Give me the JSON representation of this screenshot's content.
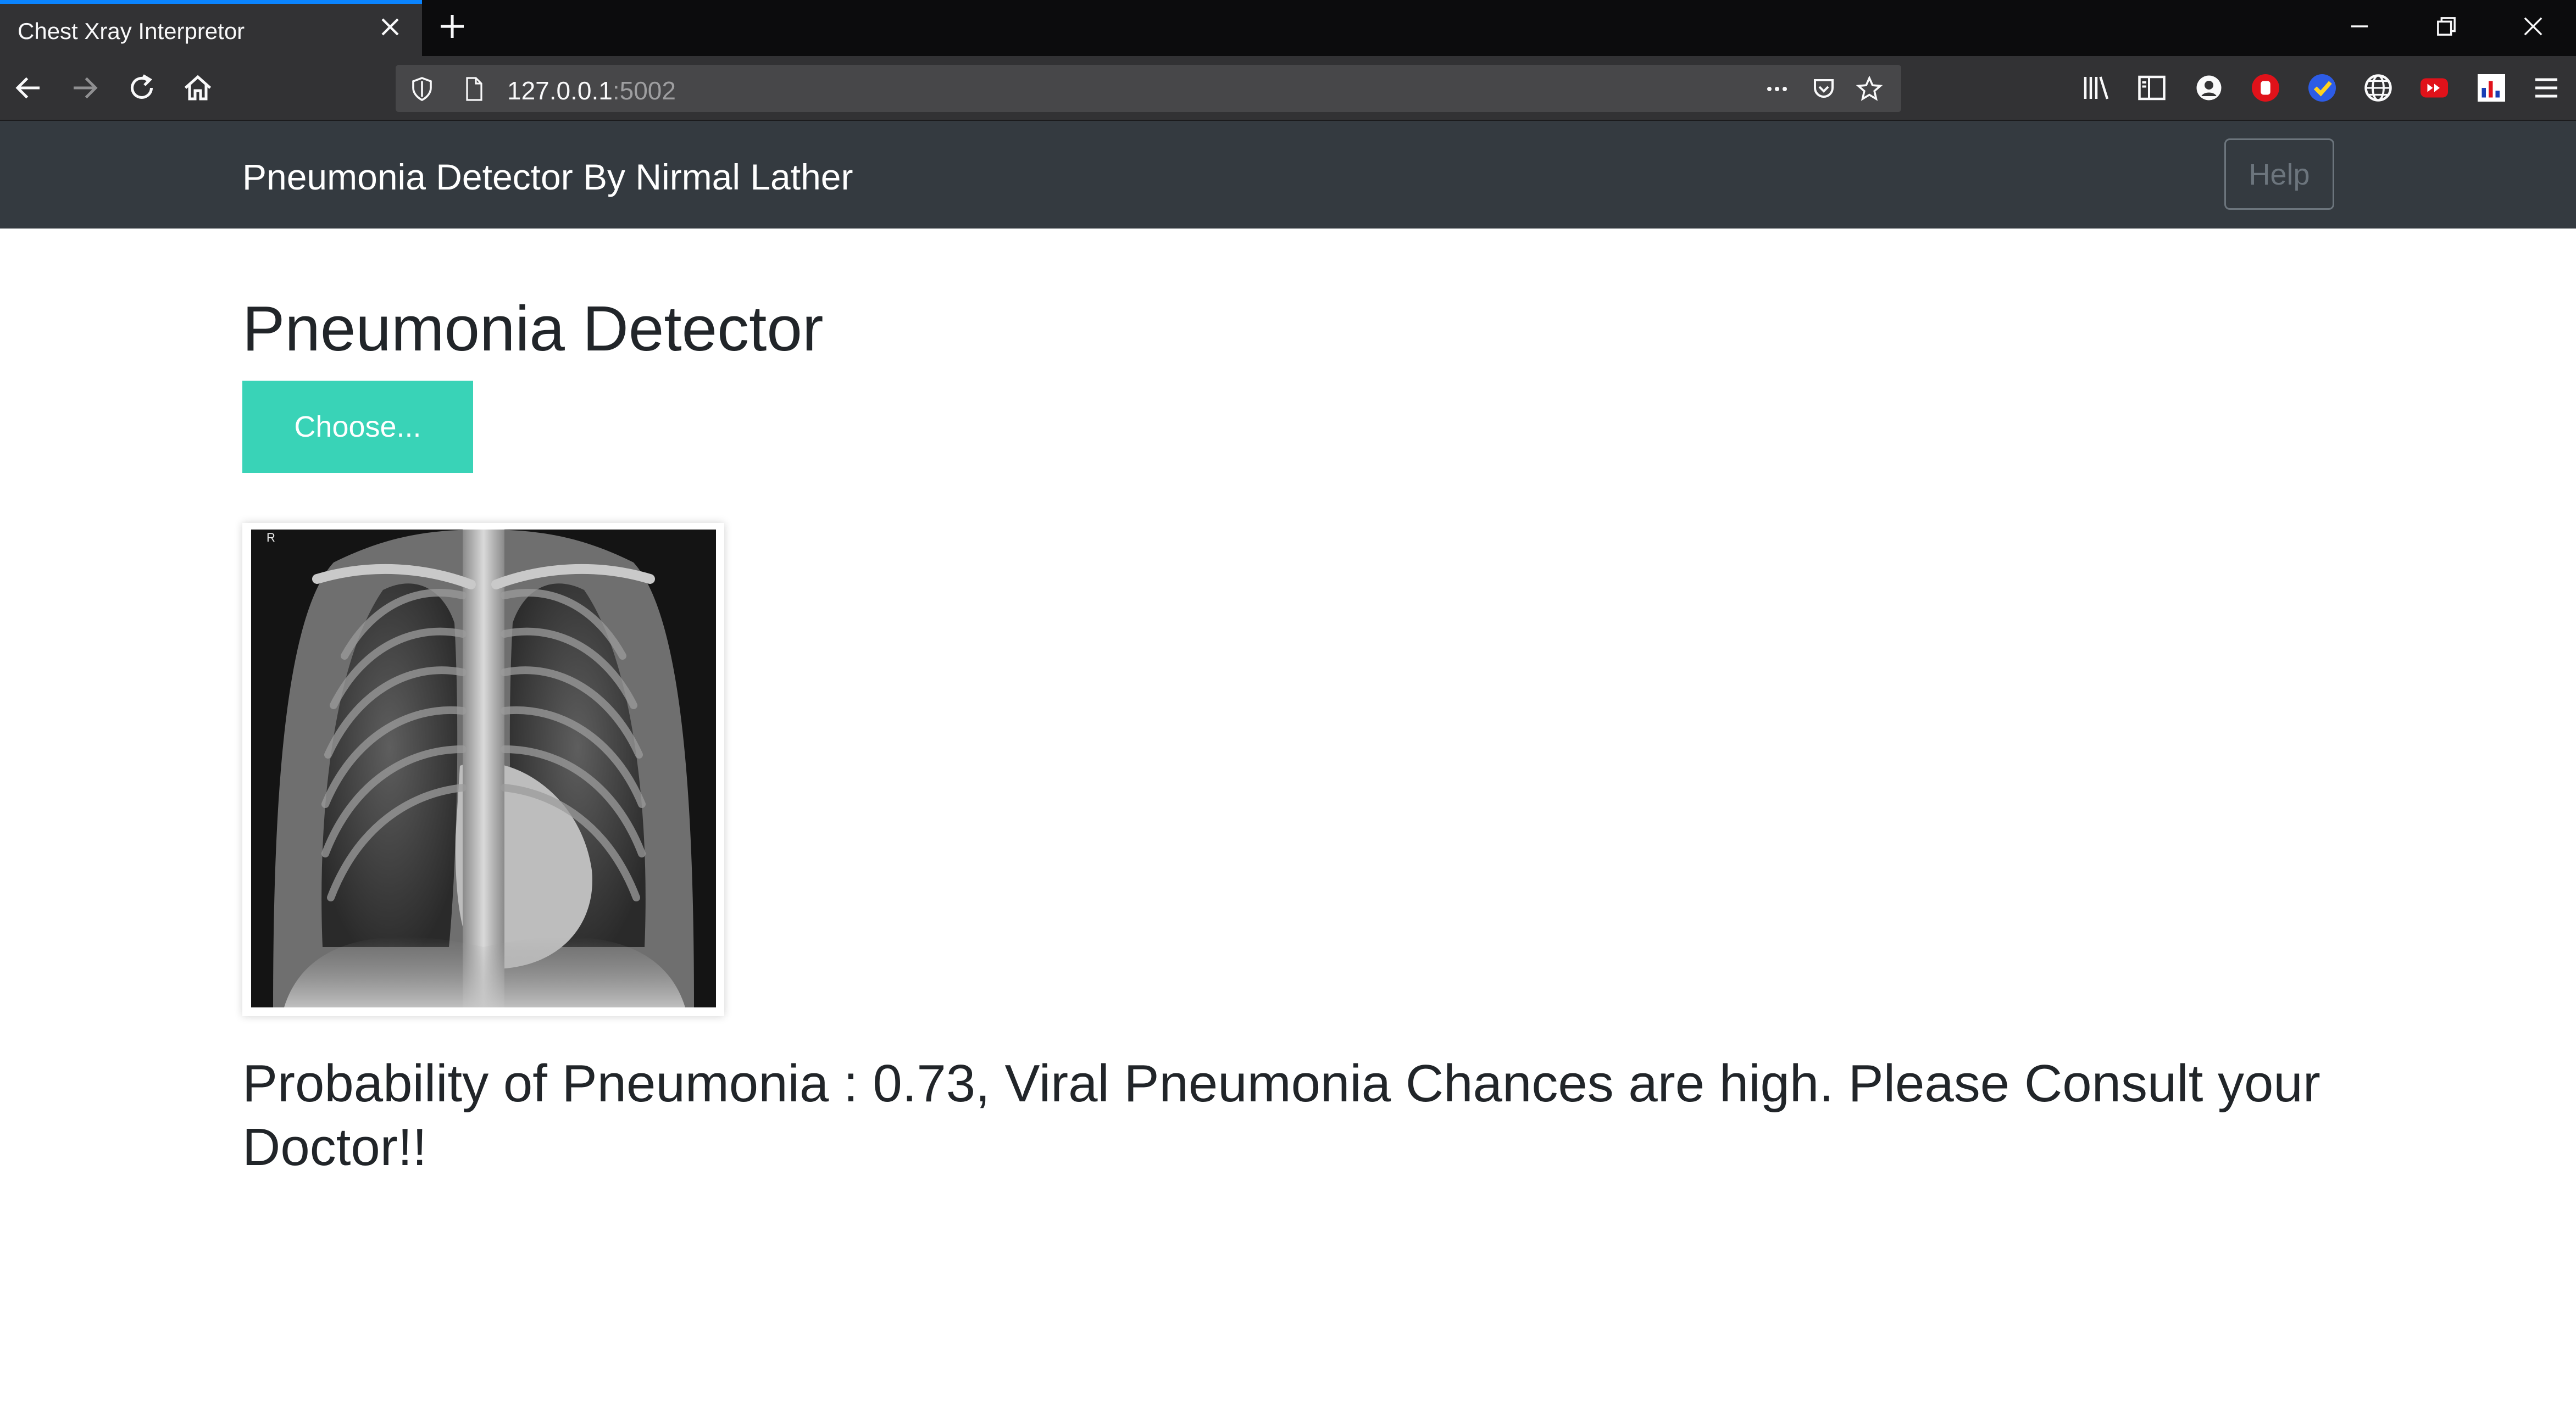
{
  "browser": {
    "tab_title": "Chest Xray Interpretor",
    "url_host": "127.0.0.1",
    "url_port": ":5002"
  },
  "navbar": {
    "brand": "Pneumonia Detector By Nirmal Lather",
    "help_label": "Help"
  },
  "main": {
    "heading": "Pneumonia Detector",
    "choose_label": "Choose...",
    "xray_marker": "R",
    "result_text": "Probability of Pneumonia : 0.73, Viral Pneumonia Chances are high. Please Consult your Doctor!!"
  },
  "colors": {
    "navbar_bg": "#343a40",
    "choose_button": "#39d3b7",
    "tab_accent": "#0a84ff"
  }
}
